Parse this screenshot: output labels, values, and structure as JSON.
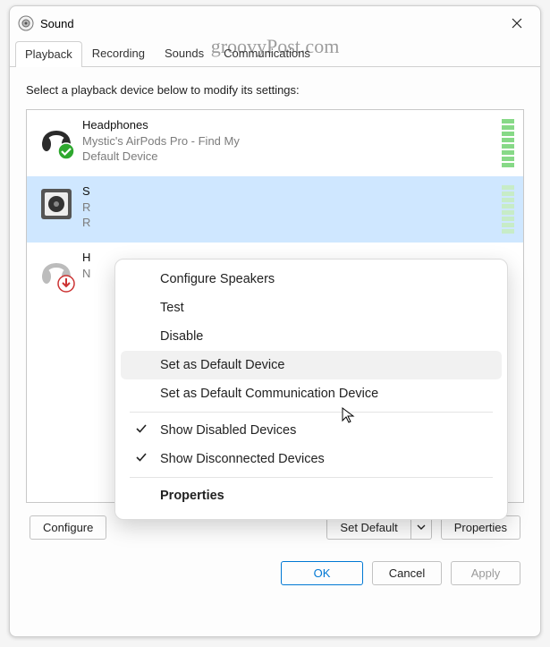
{
  "window": {
    "title": "Sound"
  },
  "watermark": "groovyPost.com",
  "tabs": [
    {
      "label": "Playback",
      "active": true
    },
    {
      "label": "Recording",
      "active": false
    },
    {
      "label": "Sounds",
      "active": false
    },
    {
      "label": "Communications",
      "active": false
    }
  ],
  "instructions": "Select a playback device below to modify its settings:",
  "devices": [
    {
      "name": "Headphones",
      "sub1": "Mystic's AirPods Pro - Find My",
      "sub2": "Default Device",
      "icon": "headphones-default"
    },
    {
      "name": "S",
      "sub1": "R",
      "sub2": "R",
      "icon": "speaker",
      "selected": true
    },
    {
      "name": "H",
      "sub1": "N",
      "sub2": "",
      "icon": "headphones-disconnected"
    }
  ],
  "context_menu": {
    "items": [
      {
        "label": "Configure Speakers"
      },
      {
        "label": "Test"
      },
      {
        "label": "Disable"
      },
      {
        "label": "Set as Default Device",
        "hover": true
      },
      {
        "label": "Set as Default Communication Device"
      },
      {
        "sep": true
      },
      {
        "label": "Show Disabled Devices",
        "checked": true
      },
      {
        "label": "Show Disconnected Devices",
        "checked": true
      },
      {
        "sep": true
      },
      {
        "label": "Properties",
        "bold": true
      }
    ]
  },
  "buttons": {
    "configure": "Configure",
    "set_default": "Set Default",
    "properties": "Properties",
    "ok": "OK",
    "cancel": "Cancel",
    "apply": "Apply"
  }
}
